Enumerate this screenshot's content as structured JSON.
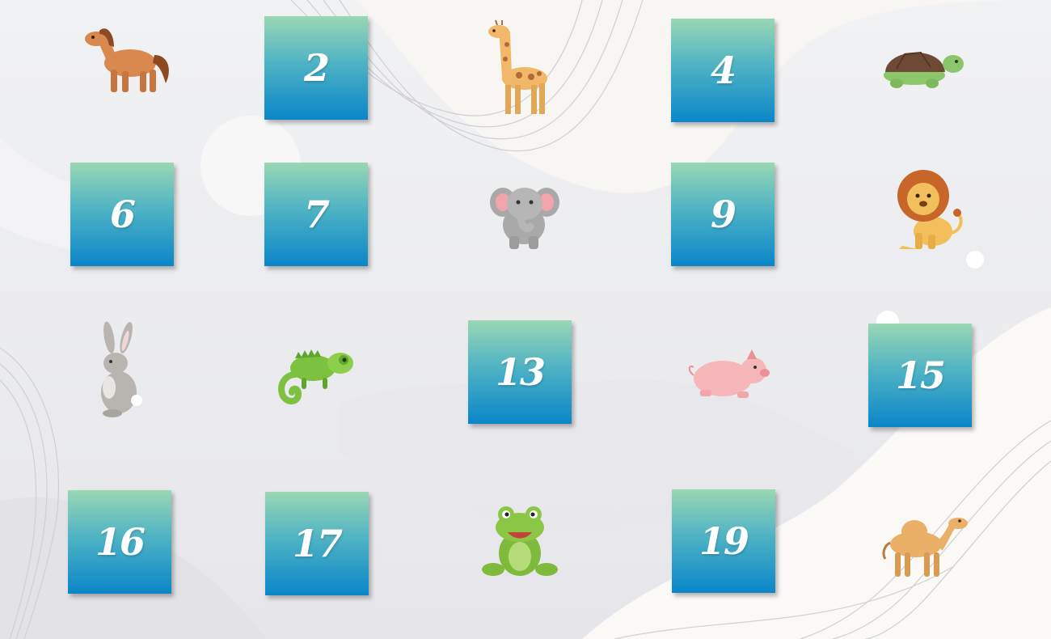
{
  "board": {
    "cells": [
      {
        "kind": "animal",
        "animal": "horse-icon"
      },
      {
        "kind": "number",
        "label": "2"
      },
      {
        "kind": "animal",
        "animal": "giraffe-icon"
      },
      {
        "kind": "number",
        "label": "4"
      },
      {
        "kind": "animal",
        "animal": "turtle-icon"
      },
      {
        "kind": "number",
        "label": "6"
      },
      {
        "kind": "number",
        "label": "7"
      },
      {
        "kind": "animal",
        "animal": "elephant-icon"
      },
      {
        "kind": "number",
        "label": "9"
      },
      {
        "kind": "animal",
        "animal": "lion-icon"
      },
      {
        "kind": "animal",
        "animal": "rabbit-icon"
      },
      {
        "kind": "animal",
        "animal": "chameleon-icon"
      },
      {
        "kind": "number",
        "label": "13"
      },
      {
        "kind": "animal",
        "animal": "pig-icon"
      },
      {
        "kind": "number",
        "label": "15"
      },
      {
        "kind": "number",
        "label": "16"
      },
      {
        "kind": "number",
        "label": "17"
      },
      {
        "kind": "animal",
        "animal": "frog-icon"
      },
      {
        "kind": "number",
        "label": "19"
      },
      {
        "kind": "animal",
        "animal": "camel-icon"
      }
    ]
  },
  "colors": {
    "tile_top": "#9ad7b4",
    "tile_bottom": "#0a86c9",
    "tile_text": "#ffffff",
    "background": "#eeeff1"
  }
}
